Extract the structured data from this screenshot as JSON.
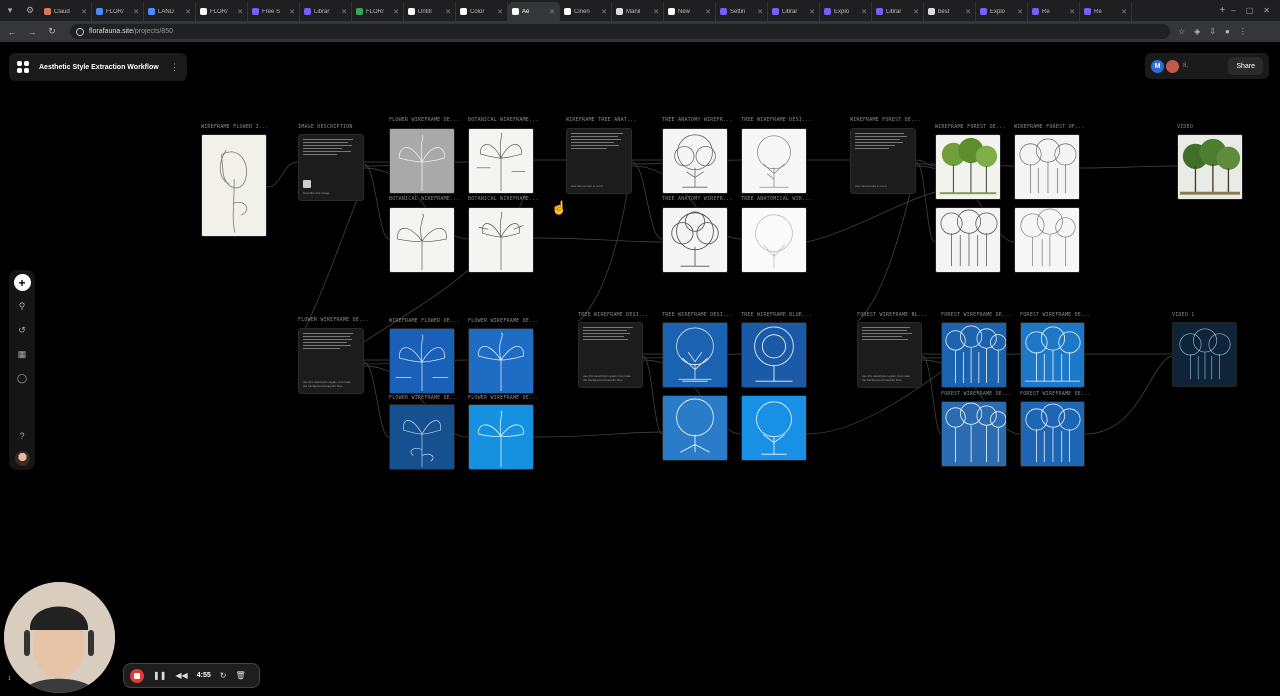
{
  "browser": {
    "tabs": [
      {
        "label": "Claud",
        "color": "#d97757"
      },
      {
        "label": "FLOR/",
        "color": "#4a8cff"
      },
      {
        "label": "LAND",
        "color": "#4a8cff"
      },
      {
        "label": "FLOR/",
        "color": "#ffffff"
      },
      {
        "label": "Free S",
        "color": "#7b5cff"
      },
      {
        "label": "Librar",
        "color": "#7b5cff"
      },
      {
        "label": "FLOR/",
        "color": "#34a853"
      },
      {
        "label": "Untitl",
        "color": "#ffffff"
      },
      {
        "label": "Color",
        "color": "#ffffff"
      },
      {
        "label": "Ae",
        "color": "#ffffff",
        "active": true
      },
      {
        "label": "Cinen",
        "color": "#ffffff"
      },
      {
        "label": "Manil",
        "color": "#dddddd"
      },
      {
        "label": "New",
        "color": "#ffffff"
      },
      {
        "label": "Settin",
        "color": "#7b5cff"
      },
      {
        "label": "Librar",
        "color": "#7b5cff"
      },
      {
        "label": "Explo",
        "color": "#7b5cff"
      },
      {
        "label": "Librar",
        "color": "#7b5cff"
      },
      {
        "label": "best",
        "color": "#dddddd"
      },
      {
        "label": "Explo",
        "color": "#7b5cff"
      },
      {
        "label": "Re",
        "color": "#7b5cff"
      },
      {
        "label": "Re",
        "color": "#7b5cff"
      }
    ],
    "url_host": "florafauna.site",
    "url_path": "/projects/850"
  },
  "project": {
    "title": "Aesthetic Style Extraction Workflow"
  },
  "share": {
    "avatar_initial": "M",
    "collaborators_label": "8,",
    "button_label": "Share"
  },
  "nodes": {
    "wireframe_flower": "WIREFRAME FLOWER I...",
    "image_description": "IMAGE DESCRIPTION",
    "flower_wireframe_de": "FLOWER WIREFRAME DE...",
    "botanical_wireframe": "BOTANICAL WIREFRAME...",
    "botanical_wireframe_2": "BOTANICAL WIREFRAME...",
    "botanical_wireframe_3": "BOTANICAL WIREFRAME...",
    "wireframe_tree_anat": "WIREFRAME TREE ANAT...",
    "tree_anatomy_wirefr": "TREE ANATOMY WIREFR...",
    "tree_wireframe_desi": "TREE WIREFRAME DESI...",
    "tree_anatomy_wirefr_2": "TREE ANATOMY WIREFR...",
    "tree_anatomical_wir": "TREE ANATOMICAL WIR...",
    "wireframe_forest_de": "WIREFRAME FOREST DE...",
    "wireframe_forest_de_2": "WIREFRAME FOREST DE...",
    "wireframe_forest_of": "WIREFRAME FOREST OF...",
    "video": "VIDEO",
    "flower_wireframe_de_2": "FLOWER WIREFRAME DE...",
    "wireframe_flower_de": "WIREFRAME FLOWER DE...",
    "flower_wireframe_de_3": "FLOWER WIREFRAME DE...",
    "flower_wireframe_de_4": "FLOWER WIREFRAME DE...",
    "flower_wireframe_de_5": "FLOWER WIREFRAME DE...",
    "tree_wireframe_desi_2": "TREE WIREFRAME DESI...",
    "tree_wireframe_desi_3": "TREE WIREFRAME DESI...",
    "tree_wireframe_blue": "TREE WIREFRAME BLUE...",
    "forest_wireframe_bl": "FOREST WIREFRAME BL...",
    "forest_wireframe_de": "FOREST WIREFRAME DE...",
    "forest_wireframe_de_2": "FOREST WIREFRAME DE...",
    "forest_wireframe_de_3": "FOREST WIREFRAME DE...",
    "forest_wireframe_de_4": "FOREST WIREFRAME DE...",
    "video_1": "VIDEO 1"
  },
  "text_nodes": {
    "img_desc_foot": "Describe this image",
    "tree_desc_foot": "Use this prompt to run it",
    "forest_desc_foot": "Use this prompt to run it",
    "flower_blue_foot": "use this description again, but make the background blueprint blue",
    "tree_blue_foot": "use this description again, but make the background blueprint blue",
    "forest_blue_foot": "use this description again, but make the background blueprint blue"
  },
  "recorder": {
    "time": "4:55",
    "webcam_badge": "1"
  },
  "colors": {
    "accent_blue": "#2d6fd6",
    "record_red": "#e53935",
    "blueprint": "#1a5fb8"
  }
}
